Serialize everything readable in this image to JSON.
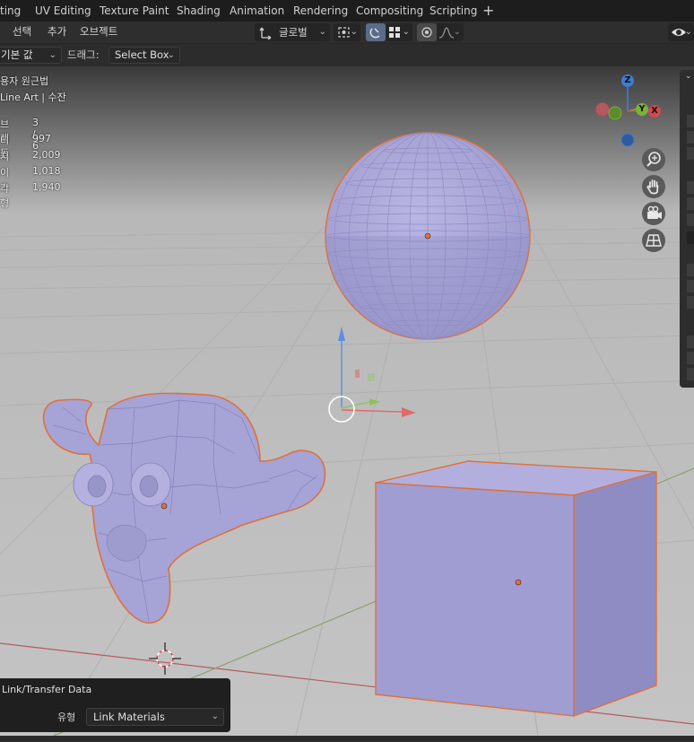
{
  "workspace_tabs": [
    "ting",
    "UV Editing",
    "Texture Paint",
    "Shading",
    "Animation",
    "Rendering",
    "Compositing",
    "Scripting"
  ],
  "add_tab_symbol": "+",
  "header": {
    "menus": [
      "선택",
      "추가",
      "오브젝트"
    ],
    "transform_orientation": "글로벌"
  },
  "toolbar": {
    "orientation_value": "기본 값",
    "drag_label": "드래그:",
    "drag_value": "Select Box"
  },
  "viewport": {
    "view_name": "용자 원근법",
    "collection": "Line Art | 수잔",
    "stats": [
      {
        "key": "브젝트",
        "value": "3 / 6"
      },
      {
        "key": "티스",
        "value": "997"
      },
      {
        "key": "지",
        "value": "2,009"
      },
      {
        "key": "이스",
        "value": "1,018"
      },
      {
        "key": "각형",
        "value": "1,940"
      }
    ],
    "gizmo_axes": [
      "Z",
      "Y",
      "X"
    ],
    "navigation_icons": [
      "zoom-icon",
      "hand-pan-icon",
      "camera-icon",
      "ortho-grid-icon"
    ]
  },
  "redo_panel": {
    "title": "Link/Transfer Data",
    "type_label": "유형",
    "type_value": "Link Materials"
  },
  "colors": {
    "selection_outline": "#e0703a",
    "object_fill": "#a9a6d8",
    "axis_x": "#d4484f",
    "axis_y": "#7bb23a",
    "axis_z": "#3d7cd6"
  }
}
